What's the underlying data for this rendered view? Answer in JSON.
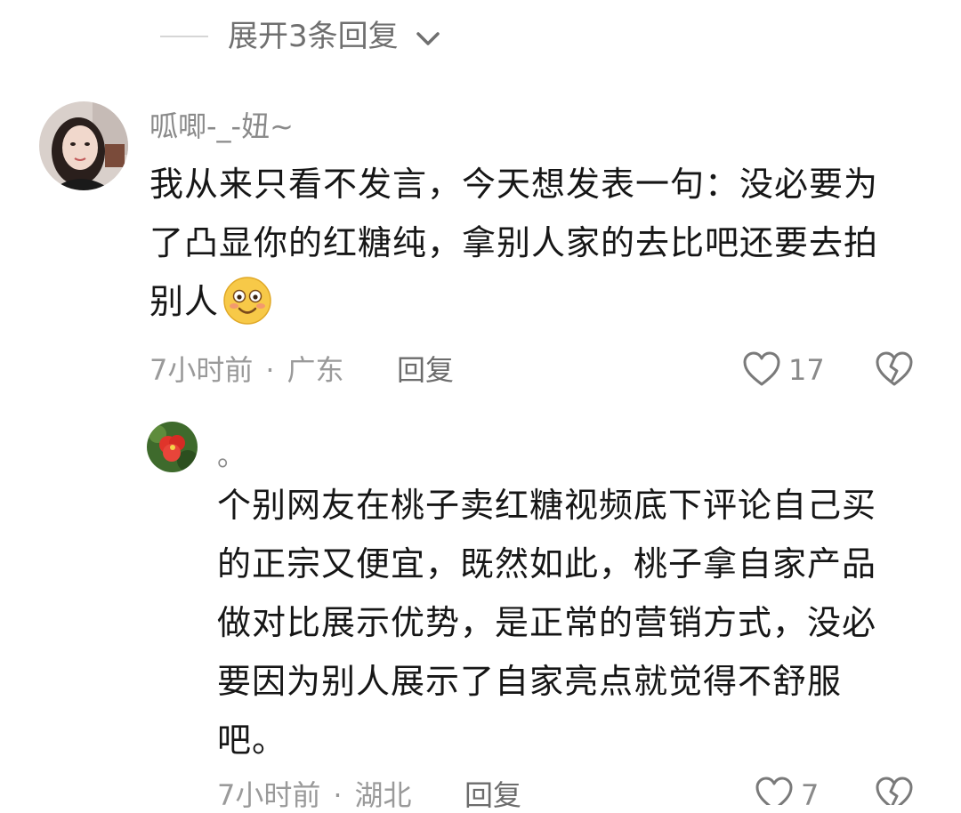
{
  "expand": {
    "label": "展开3条回复",
    "icon": "chevron-down-icon"
  },
  "comments": [
    {
      "username": "呱唧-_-妞~",
      "lines": [
        "我从来只看不发言，今天想发表一句：没必要为",
        "了凸显你的红糖纯，拿别人家的去比吧还要去拍",
        "别人"
      ],
      "emoji": "blush-smile-emoji",
      "time": "7小时前",
      "separator": "·",
      "location": "广东",
      "reply_label": "回复",
      "likes": "17"
    },
    {
      "username": "。",
      "lines": [
        "个别网友在桃子卖红糖视频底下评论自己买",
        "的正宗又便宜，既然如此，桃子拿自家产品",
        "做对比展示优势，是正常的营销方式，没必",
        "要因为别人展示了自家亮点就觉得不舒服",
        "吧。"
      ],
      "time": "7小时前",
      "separator": "·",
      "location": "湖北",
      "reply_label": "回复",
      "likes": "7"
    }
  ],
  "colors": {
    "text": "#161616",
    "secondary": "#8a8a8a",
    "divider": "#d6d6d6",
    "emoji_face": "#f7c948"
  }
}
